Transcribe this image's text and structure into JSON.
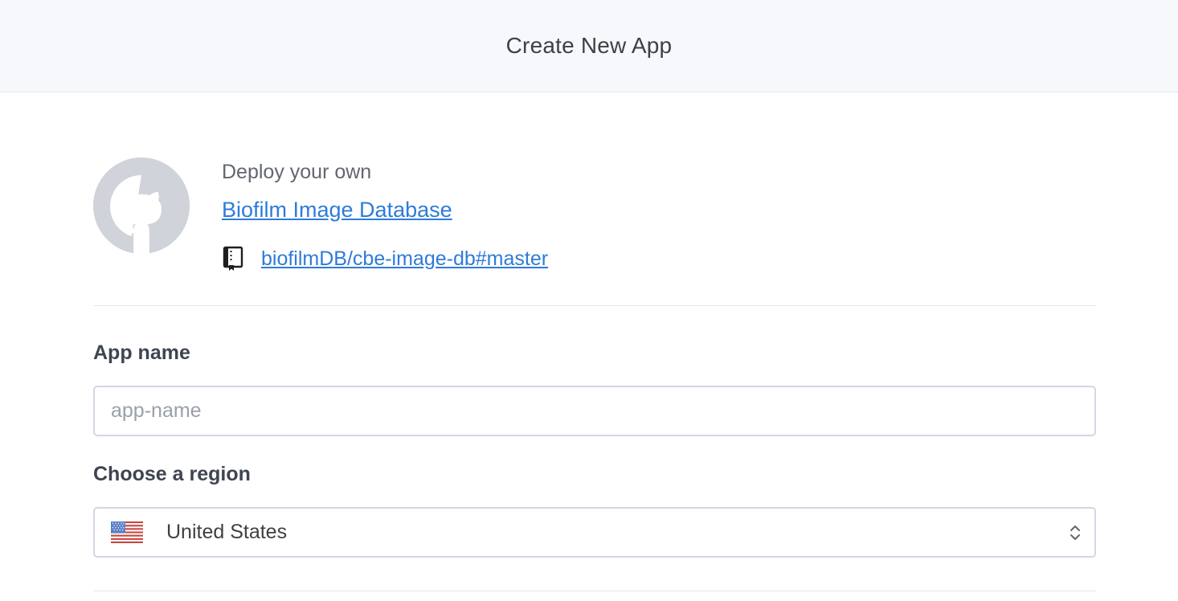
{
  "header": {
    "title": "Create New App"
  },
  "deploy": {
    "label": "Deploy your own",
    "app_link": "Biofilm Image Database",
    "repo_link": "biofilmDB/cbe-image-db#master",
    "avatar_icon": "github-icon",
    "repo_icon": "repo-book-icon"
  },
  "form": {
    "app_name": {
      "label": "App name",
      "placeholder": "app-name",
      "value": ""
    },
    "region": {
      "label": "Choose a region",
      "selected": "United States",
      "flag_icon": "us-flag-icon",
      "chevron_icon": "chevron-up-down-icon"
    }
  },
  "colors": {
    "header_bg": "#f7f8fb",
    "link": "#2f7bd8",
    "avatar_bg": "#d0d3d9",
    "input_border": "#d3d7e2"
  }
}
